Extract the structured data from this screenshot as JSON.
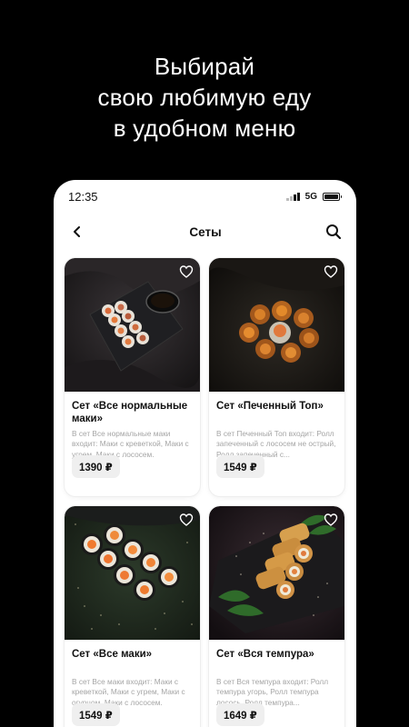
{
  "promo": {
    "line1": "Выбирай",
    "line2": "свою любимую еду",
    "line3": "в удобном меню"
  },
  "status_bar": {
    "time": "12:35",
    "network": "5G"
  },
  "header": {
    "title": "Сеты",
    "back_icon": "chevron-left-icon",
    "search_icon": "search-icon"
  },
  "products": [
    {
      "title": "Сет «Все нормальные маки»",
      "description": "В сет Все нормальные маки входит: Маки с креветкой, Маки с угрем, Маки с лососем.",
      "price": "1390 ₽",
      "image": "maki-set-photo"
    },
    {
      "title": "Сет «Печенный Топ»",
      "description": "В сет Печенный Топ входит: Ролл запеченный с лососем не острый, Ролл запеченный с...",
      "price": "1549 ₽",
      "image": "baked-rolls-photo"
    },
    {
      "title": "Сет «Все маки»",
      "description": "В сет Все маки входит: Маки с креветкой, Маки с угрем, Маки с огурцом, Маки с лососем.",
      "price": "1549 ₽",
      "image": "all-maki-photo"
    },
    {
      "title": "Сет «Вся темпура»",
      "description": "В сет Вся темпура входит: Ролл темпура угорь, Ролл темпура лосось, Ролл темпура...",
      "price": "1649 ₽",
      "image": "tempura-rolls-photo"
    }
  ],
  "colors": {
    "background": "#000000",
    "card": "#ffffff",
    "price_chip": "#efefef",
    "muted_text": "#a5a5a5"
  }
}
